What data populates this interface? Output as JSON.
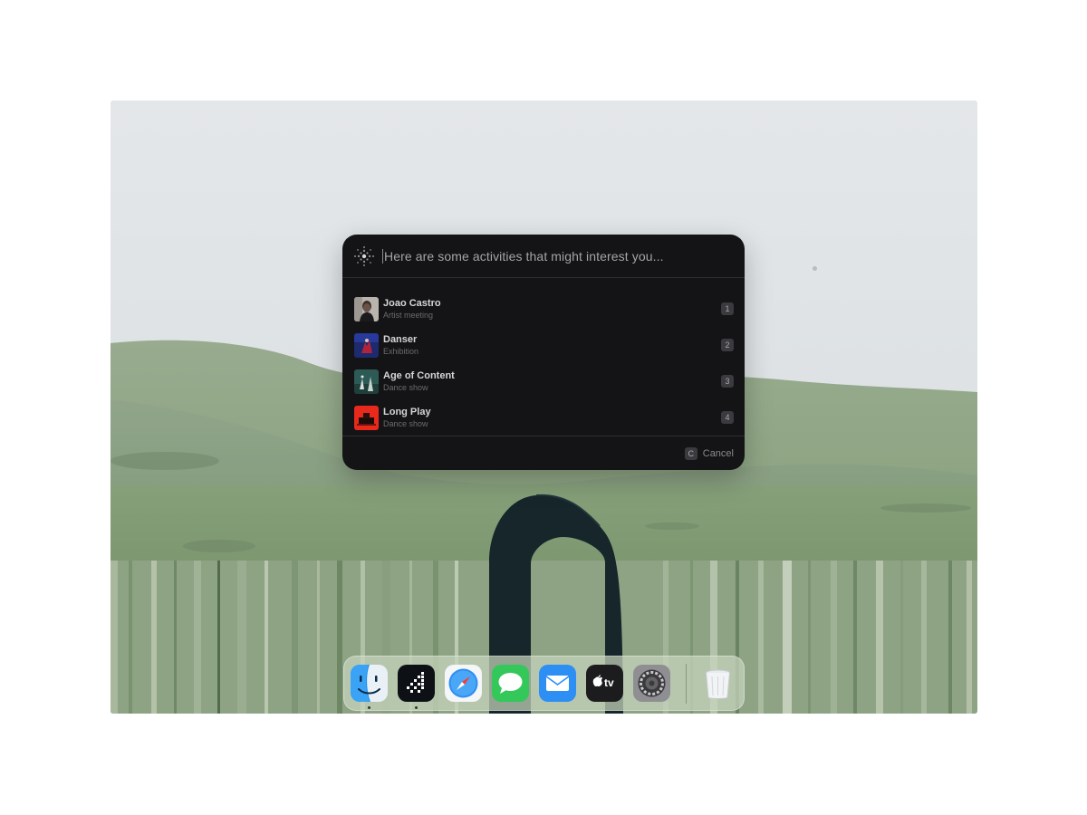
{
  "prompt": {
    "text": "Here are some activities that might interest you...",
    "icon": "sparkle-icon"
  },
  "results": [
    {
      "title": "Joao Castro",
      "subtitle": "Artist meeting",
      "shortcut": "1"
    },
    {
      "title": "Danser",
      "subtitle": "Exhibition",
      "shortcut": "2"
    },
    {
      "title": "Age of Content",
      "subtitle": "Dance show",
      "shortcut": "3"
    },
    {
      "title": "Long Play",
      "subtitle": "Dance show",
      "shortcut": "4"
    }
  ],
  "footer": {
    "cancel_key": "C",
    "cancel_label": "Cancel"
  },
  "dock": {
    "apps": [
      {
        "name": "finder-icon",
        "running": true
      },
      {
        "name": "custom-app-icon",
        "running": true
      },
      {
        "name": "safari-icon",
        "running": false
      },
      {
        "name": "messages-icon",
        "running": false
      },
      {
        "name": "mail-icon",
        "running": false
      },
      {
        "name": "apple-tv-icon",
        "running": false,
        "label": "tv"
      },
      {
        "name": "system-settings-icon",
        "running": false
      }
    ],
    "trash": "trash-icon"
  }
}
